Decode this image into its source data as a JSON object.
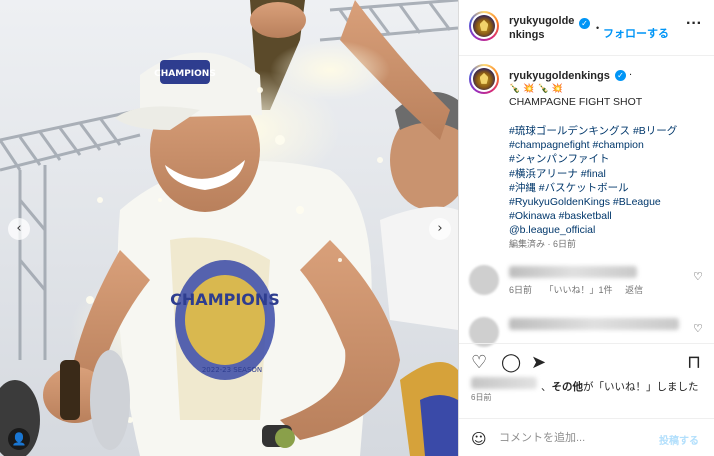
{
  "photo": {
    "cap_text": "CHAMPIONS",
    "shirt_text": "CHAMPIONS",
    "shirt_sub": "2022-23 SEASON",
    "nav_prev": "‹",
    "nav_next": "›",
    "user_tag_icon": "person-icon"
  },
  "header": {
    "username": "ryukyugoldenkings",
    "verified": "✓",
    "separator": "•",
    "follow_label": "フォローする",
    "more": "···"
  },
  "caption": {
    "username": "ryukyugoldenkings",
    "verified": "✓",
    "separator": ".",
    "emojis": [
      "🍾",
      "💥",
      "🍾",
      "💥"
    ],
    "text": "CHAMPAGNE FIGHT SHOT",
    "hashtags": [
      "#琉球ゴールデンキングス #Bリーグ",
      "#champagnefight #champion",
      "#シャンパンファイト",
      "#横浜アリーナ #final",
      "#沖縄 #バスケットボール",
      "#RyukyuGoldenKings #BLeague",
      "#Okinawa #basketball",
      "@b.league_official"
    ],
    "edited": "編集済み · 6日前"
  },
  "comments": [
    {
      "time": "6日前",
      "likes": "「いいね！」1件",
      "reply": "返信",
      "heart": "♡"
    },
    {
      "heart": "♡"
    }
  ],
  "actions": {
    "like_icon": "♡",
    "comment_icon": "◯",
    "share_icon": "➤",
    "save_icon": "⊓"
  },
  "likes": {
    "prefix": "、",
    "others": "その他",
    "suffix": "が「いいね！」しました"
  },
  "post_date": "6日前",
  "composer": {
    "emoji_icon": "☺",
    "placeholder": "コメントを追加...",
    "post_label": "投稿する"
  },
  "colors": {
    "accent": "#0095f6",
    "link": "#00376b",
    "muted": "#737373",
    "border": "#dbdbdb"
  }
}
